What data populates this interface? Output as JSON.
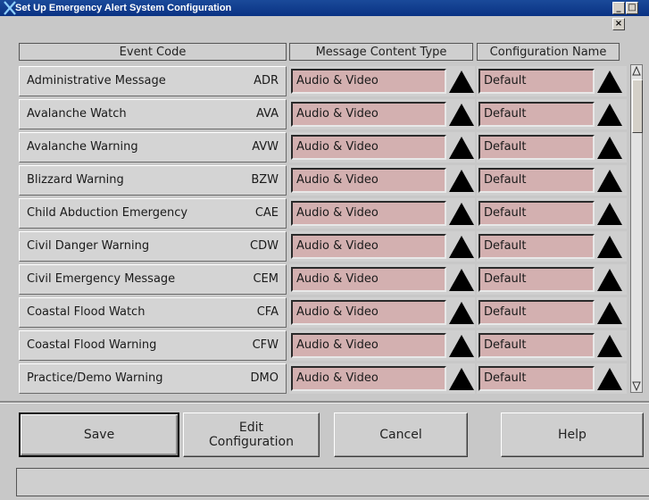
{
  "window": {
    "title": "Set Up Emergency Alert System Configuration",
    "controls": [
      "_",
      "□",
      "×"
    ]
  },
  "headers": {
    "event_code": "Event Code",
    "message_content_type": "Message Content Type",
    "configuration_name": "Configuration Name"
  },
  "rows": [
    {
      "name": "Administrative Message",
      "code": "ADR",
      "content_type": "Audio & Video",
      "config": "Default"
    },
    {
      "name": "Avalanche Watch",
      "code": "AVA",
      "content_type": "Audio & Video",
      "config": "Default"
    },
    {
      "name": "Avalanche Warning",
      "code": "AVW",
      "content_type": "Audio & Video",
      "config": "Default"
    },
    {
      "name": "Blizzard Warning",
      "code": "BZW",
      "content_type": "Audio & Video",
      "config": "Default"
    },
    {
      "name": "Child Abduction Emergency",
      "code": "CAE",
      "content_type": "Audio & Video",
      "config": "Default"
    },
    {
      "name": "Civil Danger Warning",
      "code": "CDW",
      "content_type": "Audio & Video",
      "config": "Default"
    },
    {
      "name": "Civil Emergency Message",
      "code": "CEM",
      "content_type": "Audio & Video",
      "config": "Default"
    },
    {
      "name": "Coastal Flood Watch",
      "code": "CFA",
      "content_type": "Audio & Video",
      "config": "Default"
    },
    {
      "name": "Coastal Flood Warning",
      "code": "CFW",
      "content_type": "Audio & Video",
      "config": "Default"
    },
    {
      "name": "Practice/Demo Warning",
      "code": "DMO",
      "content_type": "Audio & Video",
      "config": "Default"
    }
  ],
  "buttons": {
    "save": "Save",
    "edit_configuration": "Edit\nConfiguration",
    "cancel": "Cancel",
    "help": "Help"
  },
  "status_text": "",
  "colors": {
    "title_bar": "#0a3283",
    "field_background": "#d3b0b0",
    "panel": "#c8c8c8"
  },
  "icons": {
    "dropdown": "triangle-up-icon",
    "app": "x-logo-icon"
  }
}
